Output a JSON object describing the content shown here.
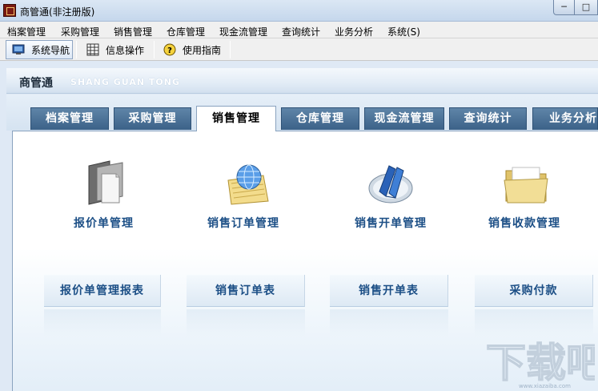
{
  "window": {
    "title": "商管通(非注册版)",
    "minimize_label": "─",
    "maximize_label": "□"
  },
  "menubar": {
    "items": [
      "档案管理",
      "采购管理",
      "销售管理",
      "仓库管理",
      "现金流管理",
      "查询统计",
      "业务分析",
      "系统(S)"
    ]
  },
  "toolbar": {
    "items": [
      {
        "label": "系统导航",
        "icon": "monitor-icon",
        "active": true
      },
      {
        "label": "信息操作",
        "icon": "grid-icon",
        "active": false
      },
      {
        "label": "使用指南",
        "icon": "help-icon",
        "active": false
      }
    ]
  },
  "header": {
    "brand": "商管通",
    "brand_en": "SHANG GUAN TONG"
  },
  "tabs": {
    "items": [
      "档案管理",
      "采购管理",
      "销售管理",
      "仓库管理",
      "现金流管理",
      "查询统计",
      "业务分析"
    ],
    "selected": "销售管理"
  },
  "modules": [
    {
      "label": "报价单管理",
      "icon": "document-stack-icon"
    },
    {
      "label": "销售订单管理",
      "icon": "globe-document-icon"
    },
    {
      "label": "销售开单管理",
      "icon": "book-icon"
    },
    {
      "label": "销售收款管理",
      "icon": "folder-icon"
    }
  ],
  "reports": [
    "报价单管理报表",
    "销售订单表",
    "销售开单表",
    "采购付款"
  ],
  "watermark": {
    "text": "下载吧",
    "url": "www.xiazaiba.com"
  },
  "colors": {
    "tab_bg": "#4a7098",
    "module_label": "#1c4f86",
    "header_bg": "#e2ecf6"
  }
}
